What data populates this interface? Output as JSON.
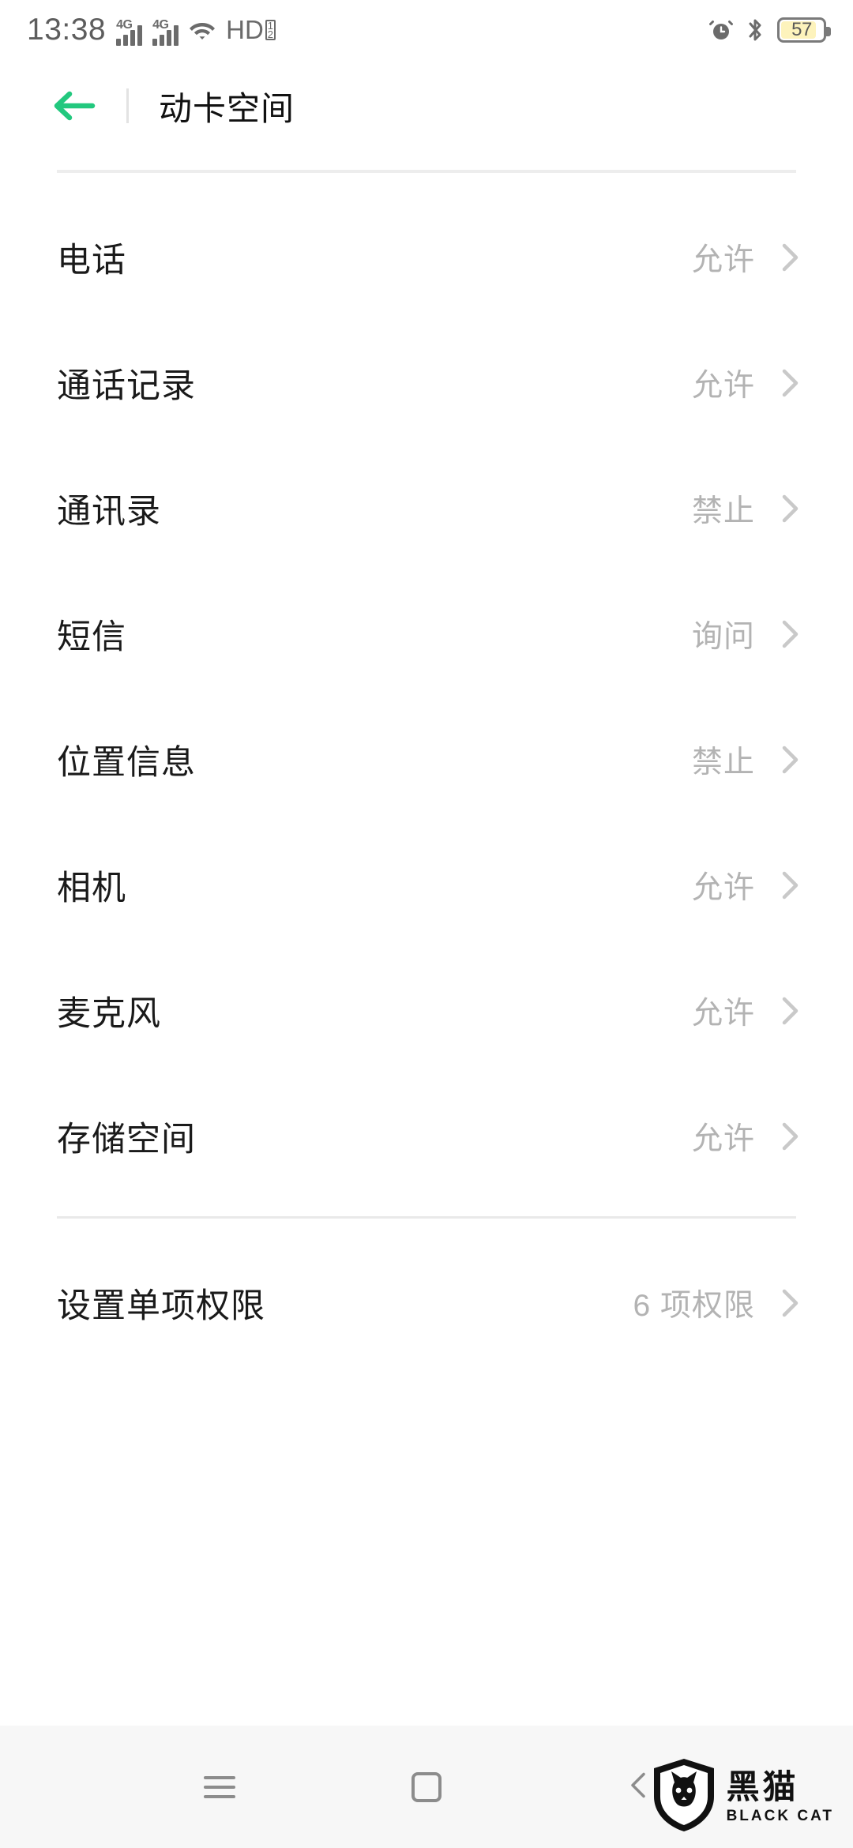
{
  "status_bar": {
    "time": "13:38",
    "network_label_1": "4G",
    "network_label_2": "4G",
    "hd_label": "HD",
    "hd_sub_top": "1",
    "hd_sub_bottom": "2",
    "battery_percent": "57",
    "icons": [
      "signal-4g-sim1-icon",
      "signal-4g-sim2-icon",
      "wifi-icon",
      "hd-volte-icon",
      "alarm-icon",
      "bluetooth-icon",
      "battery-icon"
    ],
    "battery_fill_color": "#fdf3bc",
    "icon_color": "#6b6b6b"
  },
  "header": {
    "back_icon": "arrow-left-icon",
    "back_color": "#22c87e",
    "title": "动卡空间"
  },
  "permissions": {
    "rows": [
      {
        "label": "电话",
        "value": "允许"
      },
      {
        "label": "通话记录",
        "value": "允许"
      },
      {
        "label": "通讯录",
        "value": "禁止"
      },
      {
        "label": "短信",
        "value": "询问"
      },
      {
        "label": "位置信息",
        "value": "禁止"
      },
      {
        "label": "相机",
        "value": "允许"
      },
      {
        "label": "麦克风",
        "value": "允许"
      },
      {
        "label": "存储空间",
        "value": "允许"
      }
    ]
  },
  "single_permission": {
    "label": "设置单项权限",
    "value": "6 项权限"
  },
  "nav_bar": {
    "recents_icon": "recents-menu-icon",
    "home_icon": "home-square-icon",
    "back_icon": "nav-back-triangle-icon"
  },
  "watermark": {
    "cn": "黑猫",
    "en": "BLACK CAT",
    "logo_icon": "black-cat-shield-icon"
  }
}
